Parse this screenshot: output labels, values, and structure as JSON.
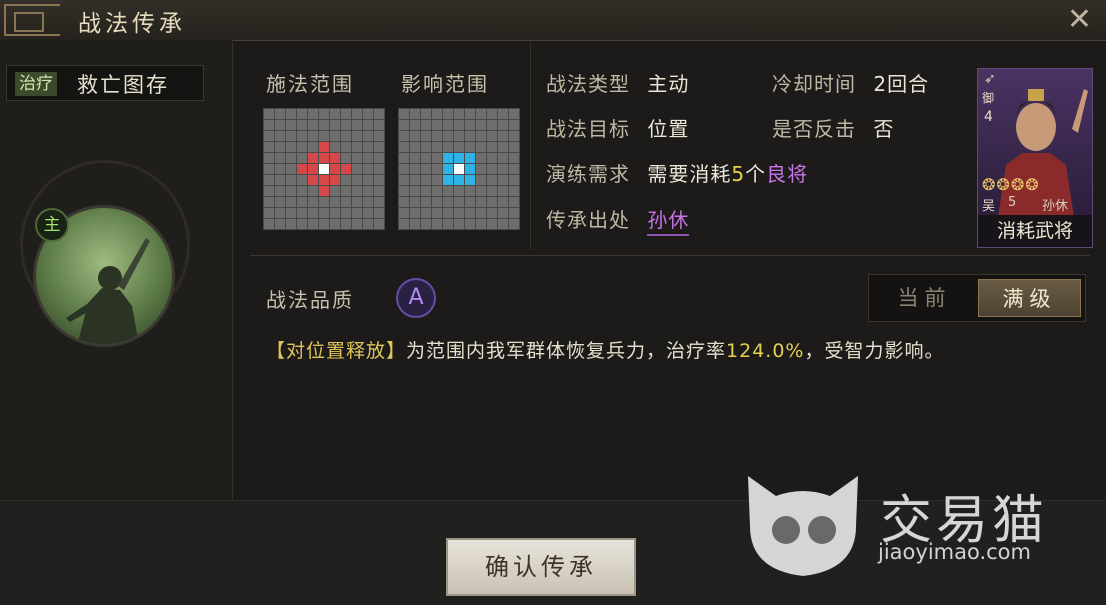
{
  "window": {
    "title": "战法传承",
    "close_icon": "close-icon"
  },
  "skill": {
    "type": "治疗",
    "name": "救亡图存",
    "main_badge": "主"
  },
  "ranges": {
    "cast_label": "施法范围",
    "effect_label": "影响范围"
  },
  "info": {
    "type_label": "战法类型",
    "type_value": "主动",
    "cooldown_label": "冷却时间",
    "cooldown_value": "2回合",
    "target_label": "战法目标",
    "target_value": "位置",
    "counter_label": "是否反击",
    "counter_value": "否",
    "req_label": "演练需求",
    "req_prefix": "需要消耗",
    "req_count": "5",
    "req_unit": "个",
    "req_quality": "良将",
    "source_label": "传承出处",
    "source_value": "孙休"
  },
  "general_card": {
    "weapon_icon": "bow-icon",
    "army": "御",
    "cost": "4",
    "stars": "❂❂❂❂",
    "faction": "吴",
    "level": "5",
    "name": "孙休",
    "caption": "消耗武将"
  },
  "quality": {
    "label": "战法品质",
    "grade": "A"
  },
  "toggle": {
    "current": "当前",
    "max": "满级"
  },
  "description": {
    "tag": "【对位置释放】",
    "text1": "为范围内我军群体恢复兵力，治疗率",
    "rate": "124.0%",
    "text2": "，受智力影响。"
  },
  "confirm_button": "确认传承",
  "watermark": {
    "name": "交易猫",
    "url": "jiaoyimao.com"
  },
  "colors": {
    "cast_cells": "#d6474a",
    "effect_cells": "#2fb2e6",
    "quality": "#6a4ca6"
  }
}
